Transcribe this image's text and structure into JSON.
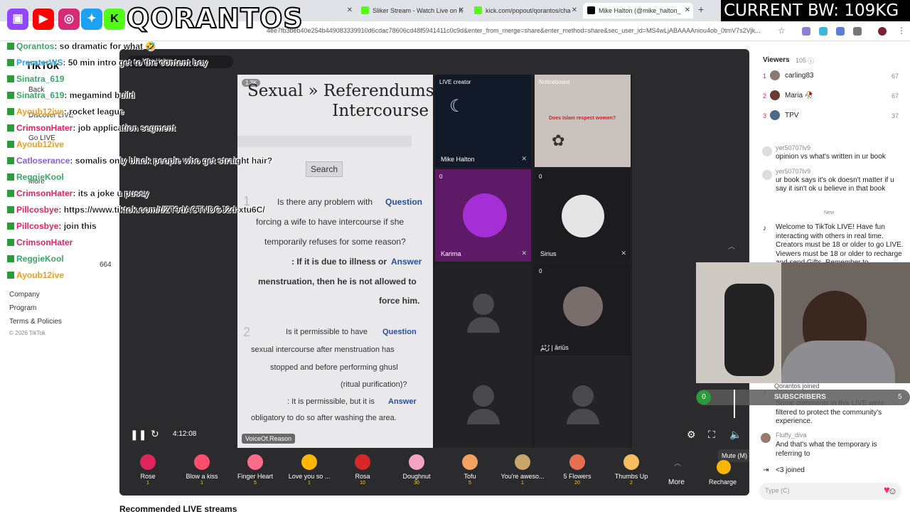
{
  "browser": {
    "tabs": [
      {
        "label": "tch",
        "color": "#9146ff"
      },
      {
        "label": "Sliker Stream - Watch Live on K",
        "color": "#53fc18"
      },
      {
        "label": "kick.com/popout/qorantos/cha",
        "color": "#53fc18"
      },
      {
        "label": "Mike Halton (@mike_halton_",
        "color": "#000000"
      }
    ],
    "new_tab": "+",
    "url": "4ee7fb3beb40e254b449083339910d6cdac78606cd48f5941411c0c9d&enter_from_merge=share&enter_method=share&sec_user_id=MS4wLjABAAAAniou4ob_0tmV7s2Vjk..."
  },
  "overlay": {
    "brand": "QORANTOS",
    "bandwidth": "CURRENT BW: 109KG",
    "socials": [
      "twitch-icon",
      "youtube-icon",
      "instagram-icon",
      "twitter-icon",
      "kick-icon"
    ]
  },
  "sidebar": {
    "logo": "TikTok",
    "nav": [
      "Back",
      "Discover LIVE",
      "Go LIVE",
      "More"
    ],
    "footer": [
      "Company",
      "Program",
      "Terms & Policies",
      "© 2026 TikTok"
    ],
    "count": "664"
  },
  "chat": [
    {
      "user": "Qorantos",
      "msg": ": so dramatic for what 🤣"
    },
    {
      "user": "PreraterWS",
      "msg": ": 50 min intro get to the content boy"
    },
    {
      "user": "Sinatra_619",
      "msg": ""
    },
    {
      "user": "Sinatra_619",
      "msg": ": megamind build"
    },
    {
      "user": "Ayoub12ive",
      "msg": ": rocket league"
    },
    {
      "user": "CrimsonHater",
      "msg": ": job application segment"
    },
    {
      "user": "Ayoub12ive",
      "msg": ""
    },
    {
      "user": "Catloserance",
      "msg": ": somalis only black people who get straight hair?"
    },
    {
      "user": "ReggieKool",
      "msg": ""
    },
    {
      "user": "CrimsonHater",
      "msg": ": its a joke u pussy"
    },
    {
      "user": "Pillcosbye",
      "msg": ": https://www.tiktok.com/t/ZT9dACTNDGJ2d-xtu6C/"
    },
    {
      "user": "Pillcosbye",
      "msg": ": join this"
    },
    {
      "user": "CrimsonHater",
      "msg": ""
    },
    {
      "user": "ReggieKool",
      "msg": ""
    },
    {
      "user": "Ayoub12ive",
      "msg": ""
    }
  ],
  "stream": {
    "host_label": "Mike Halton",
    "viewer_badge": "1.3K",
    "book": {
      "title1": "Sexual » Referendums",
      "title2": "Intercourse",
      "search": "Search",
      "q1": "Is there any problem with",
      "q1tag": "Question",
      "q1b": "forcing a wife to have intercourse if she",
      "q1c": "temporarily refuses for some reason?",
      "a1": ": If it is due to illness or",
      "a1tag": "Answer",
      "a1b": "menstruation, then he is not allowed to",
      "a1c": "force him.",
      "q2": "Is it permissible to have",
      "q2tag": "Question",
      "q2b": "sexual intercourse after menstruation has",
      "q2c": "stopped and before performing ghusl",
      "q2d": "(ritual purification)?",
      "a2": ": It is permissible, but it is",
      "a2tag": "Answer",
      "a2b": "obligatory to do so after washing the area.",
      "n1": "1",
      "n2": "2",
      "source": "VoiceOf.Reason"
    },
    "guests": [
      {
        "tag": "LIVE creator",
        "name": "Mike Halton"
      },
      {
        "tag": "Noticeboard",
        "name": "",
        "overlay": "Does Islam respect women?"
      },
      {
        "tag": "0",
        "name": "Karima"
      },
      {
        "tag": "0",
        "name": "Sirius"
      },
      {
        "tag": "",
        "name": ""
      },
      {
        "tag": "0",
        "name": "زُيْمُ | āriūs"
      },
      {
        "tag": "",
        "name": ""
      },
      {
        "tag": "",
        "name": ""
      }
    ],
    "time": "4:12:08",
    "mute_tooltip": "Mute (M)"
  },
  "gifts": [
    {
      "name": "Rose",
      "cost": "1",
      "color": "#e0245e"
    },
    {
      "name": "Blow a kiss",
      "cost": "1",
      "color": "#ff4d6d"
    },
    {
      "name": "Finger Heart",
      "cost": "5",
      "color": "#ff6b8b"
    },
    {
      "name": "Love you so ...",
      "cost": "1",
      "color": "#ffb703"
    },
    {
      "name": "Rosa",
      "cost": "10",
      "color": "#d62828"
    },
    {
      "name": "Doughnut",
      "cost": "30",
      "color": "#f4a3c0"
    },
    {
      "name": "Tofu",
      "cost": "5",
      "color": "#f4a261"
    },
    {
      "name": "You're aweso...",
      "cost": "1",
      "color": "#c9a66b"
    },
    {
      "name": "5 Flowers",
      "cost": "20",
      "color": "#e76f51"
    },
    {
      "name": "Thumbs Up",
      "cost": "2",
      "color": "#f6bd60"
    }
  ],
  "gifts_more": "More",
  "recharge": "Recharge",
  "recommended": "Recommended LIVE streams",
  "right": {
    "viewers_label": "Viewers",
    "viewers_count": "105",
    "top": [
      {
        "rank": "1",
        "name": "carling83",
        "score": "67"
      },
      {
        "rank": "2",
        "name": "Maria 🥀",
        "score": "67"
      },
      {
        "rank": "3",
        "name": "TPV",
        "score": "37"
      }
    ],
    "comments": [
      {
        "user": "yer50707lv9",
        "text": "opinion vs what's written in ur book"
      },
      {
        "user": "yer50707lv9",
        "text": "ur book says it's ok doesn't matter if u say it isn't ok u believe in that book"
      }
    ],
    "divider": "New",
    "welcome": "Welcome to TikTok LIVE! Have fun interacting with others in real time. Creators must be 18 or older to go LIVE. Viewers must be 18 or older to recharge and send Gifts. Remember to",
    "subs_label": "SUBSCRIBERS",
    "subs_count": "5",
    "sub_counter": "0",
    "joined1": "Qorantos joined",
    "filter_note": "Some comments in this LIVE were filtered to protect the community's experience.",
    "fluffy_user": "Fluffy_diva",
    "fluffy_text": "And that's what the temporary is referring to",
    "joined2": "<3 joined",
    "input_placeholder": "Type (C)"
  }
}
